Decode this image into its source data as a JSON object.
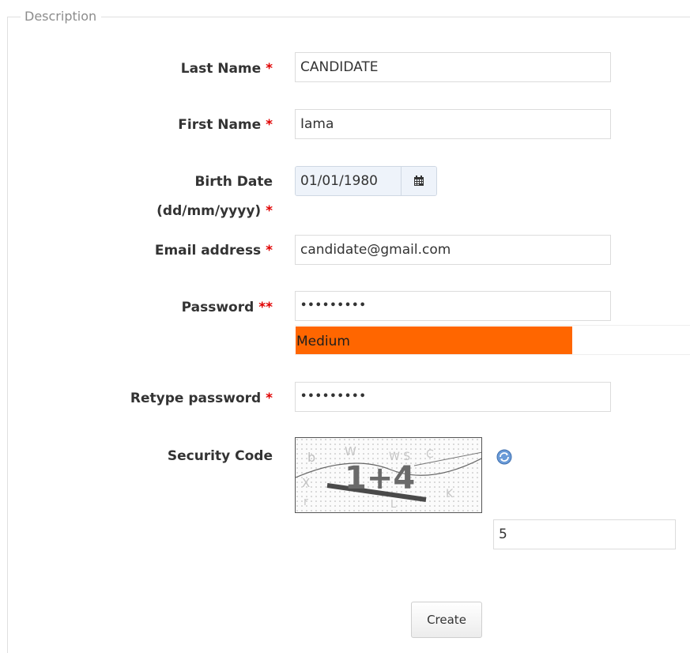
{
  "fieldset": {
    "legend": "Description"
  },
  "fields": {
    "last_name": {
      "label": "Last Name",
      "required": "*",
      "value": "CANDIDATE"
    },
    "first_name": {
      "label": "First Name",
      "required": "*",
      "value": "Iama"
    },
    "birth_date": {
      "label_line1": "Birth Date",
      "label_line2": "(dd/mm/yyyy)",
      "required": "*",
      "value": "01/01/1980",
      "button_icon": "calendar-icon"
    },
    "email": {
      "label": "Email address",
      "required": "*",
      "value": "candidate@gmail.com"
    },
    "password": {
      "label": "Password",
      "required": "**",
      "masked_value": "•••••••••"
    },
    "password_strength": {
      "text": "Medium",
      "level": 0.7,
      "color": "#ff6600"
    },
    "retype_password": {
      "label": "Retype password",
      "required": "*",
      "masked_value": "•••••••••"
    },
    "security_code": {
      "label": "Security Code",
      "captcha_text": "1+4",
      "refresh_icon": "refresh-icon",
      "value": "5"
    }
  },
  "actions": {
    "create_label": "Create"
  },
  "colors": {
    "required": "#e00000",
    "legend": "#8c8c8c",
    "strength_medium": "#ff6600"
  }
}
